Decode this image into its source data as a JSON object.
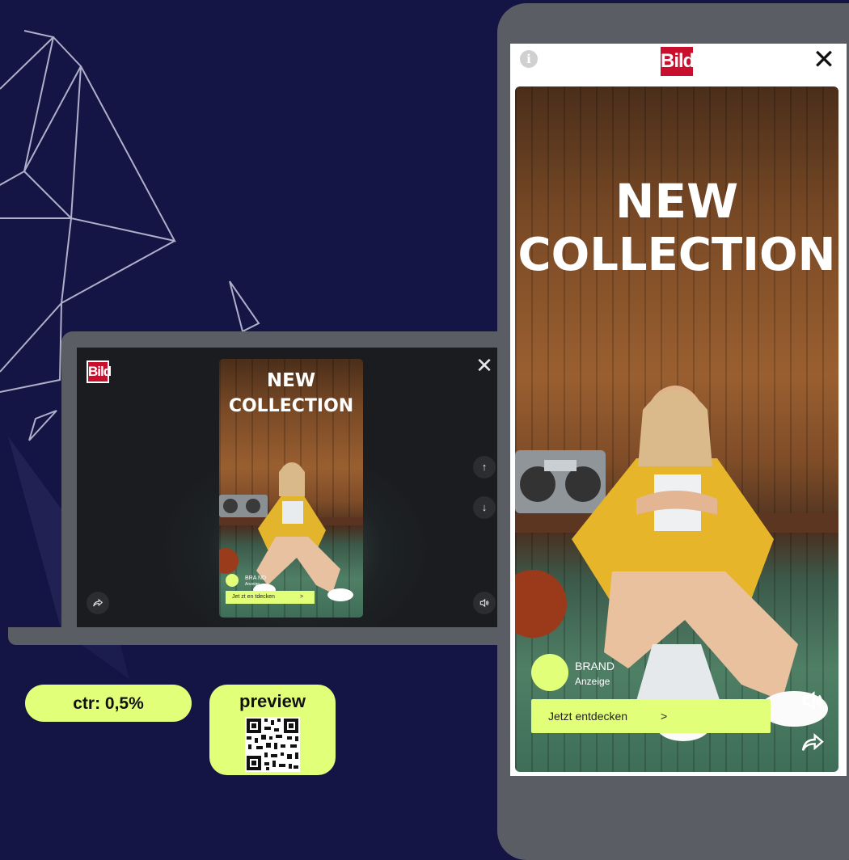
{
  "colors": {
    "background": "#141545",
    "accent": "#e2ff7a",
    "bild_red": "#c8102e",
    "device": "#5a5d64"
  },
  "laptop": {
    "logo": "Bild",
    "close_icon": "close-icon",
    "up_icon": "arrow-up-icon",
    "down_icon": "arrow-down-icon",
    "share_icon": "share-icon",
    "sound_icon": "speaker-icon",
    "story": {
      "headline_1": "NEW",
      "headline_2": "COLLECTION",
      "brand": "BRA ND",
      "brand_sub": "Anzeige",
      "cta": "Jet zt en tdecken",
      "cta_arrow": ">"
    }
  },
  "phone": {
    "logo": "Bild",
    "info_icon": "info-icon",
    "close_icon": "close-icon",
    "story": {
      "headline_1": "NEW",
      "headline_2": "COLLECTION",
      "brand": "BRAND",
      "brand_sub": "Anzeige",
      "cta": "Jetzt entdecken",
      "cta_arrow": ">",
      "sound_icon": "speaker-icon",
      "share_icon": "share-icon"
    }
  },
  "badges": {
    "ctr": "ctr:  0,5%",
    "preview": "preview",
    "qr_icon": "qr-code-icon"
  }
}
